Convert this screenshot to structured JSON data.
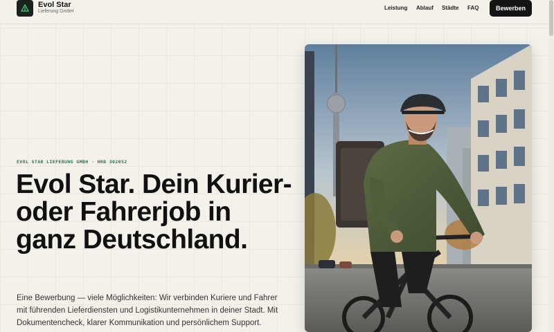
{
  "header": {
    "brand_name": "Evol Star",
    "brand_sub": "Lieferung GmbH",
    "nav": [
      "Leistung",
      "Ablauf",
      "Städte",
      "FAQ"
    ],
    "cta_label": "Bewerben"
  },
  "hero": {
    "eyebrow": "EVOL STAR LIEFERUNG GMBH · HRB 302052",
    "headline": "Evol Star. Dein Kurier- oder Fahrerjob in ganz Deutschland.",
    "intro": "Eine Bewerbung — viele Möglichkeiten: Wir verbinden Kuriere und Fahrer mit führenden Lieferdiensten und Logistikunternehmen in deiner Stadt. Mit Dokumentencheck, klarer Kommunikation und persönlichem Support."
  },
  "colors": {
    "background": "#f4f1ea",
    "accent_green": "#1f7a4d",
    "cta_background": "#141414"
  }
}
